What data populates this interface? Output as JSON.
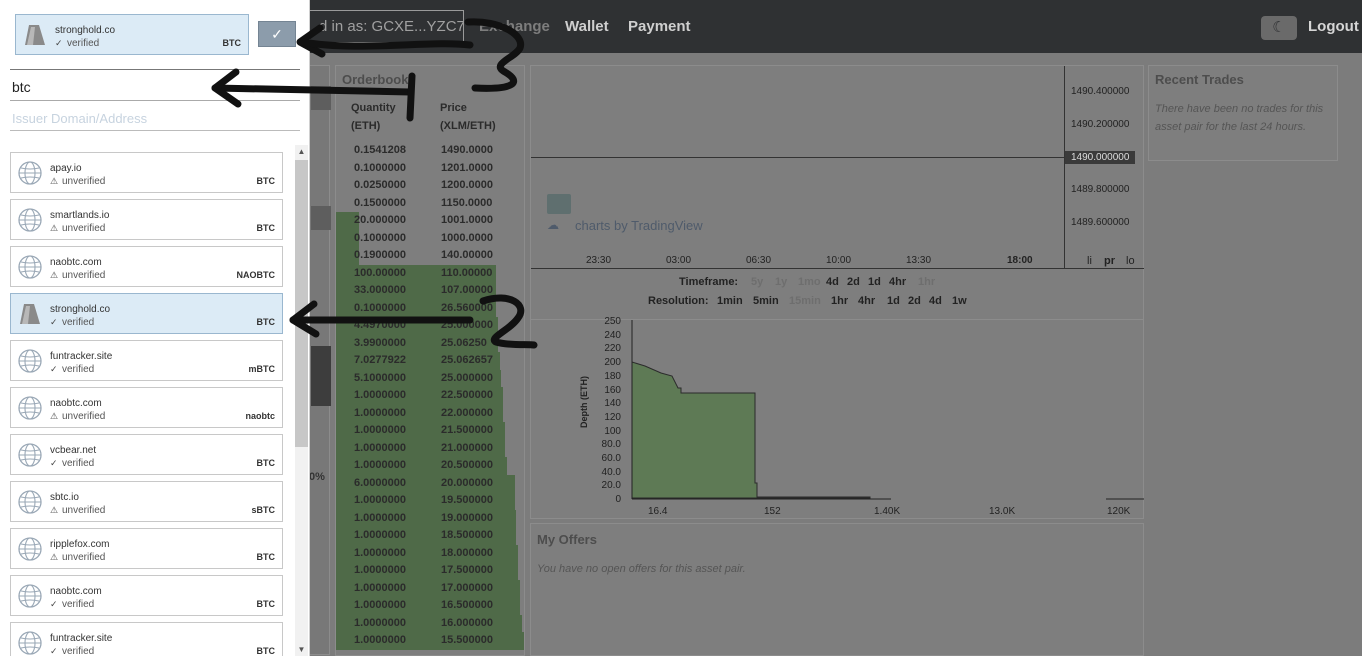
{
  "header": {
    "logged_in_text": "d in as: GCXE...YZC7",
    "nav": [
      "Exchange",
      "Wallet",
      "Payment"
    ],
    "logout": "Logout"
  },
  "orderbook": {
    "title": "Orderbook",
    "col_qty": "Quantity",
    "col_qty_unit": "(ETH)",
    "col_price": "Price",
    "col_price_unit": "(XLM/ETH)",
    "rows": [
      {
        "q": "0.1541208",
        "p": "1490.0000",
        "depth": 0.0
      },
      {
        "q": "0.1000000",
        "p": "1201.0000",
        "depth": 0.0
      },
      {
        "q": "0.0250000",
        "p": "1200.0000",
        "depth": 0.0
      },
      {
        "q": "0.1500000",
        "p": "1150.0000",
        "depth": 0.0
      },
      {
        "q": "20.000000",
        "p": "1001.0000",
        "depth": 0.12
      },
      {
        "q": "0.1000000",
        "p": "1000.0000",
        "depth": 0.12
      },
      {
        "q": "0.1900000",
        "p": "140.00000",
        "depth": 0.12
      },
      {
        "q": "100.00000",
        "p": "110.00000",
        "depth": 0.85
      },
      {
        "q": "33.000000",
        "p": "107.00000",
        "depth": 0.85
      },
      {
        "q": "0.1000000",
        "p": "26.560000",
        "depth": 0.85
      },
      {
        "q": "4.4970000",
        "p": "25.000000",
        "depth": 0.86
      },
      {
        "q": "3.9900000",
        "p": "25.06250",
        "depth": 0.86
      },
      {
        "q": "7.0277922",
        "p": "25.062657",
        "depth": 0.87
      },
      {
        "q": "5.1000000",
        "p": "25.000000",
        "depth": 0.88
      },
      {
        "q": "1.0000000",
        "p": "22.500000",
        "depth": 0.89
      },
      {
        "q": "1.0000000",
        "p": "22.000000",
        "depth": 0.89
      },
      {
        "q": "1.0000000",
        "p": "21.500000",
        "depth": 0.9
      },
      {
        "q": "1.0000000",
        "p": "21.000000",
        "depth": 0.9
      },
      {
        "q": "1.0000000",
        "p": "20.500000",
        "depth": 0.91
      },
      {
        "q": "6.0000000",
        "p": "20.000000",
        "depth": 0.95
      },
      {
        "q": "1.0000000",
        "p": "19.500000",
        "depth": 0.95
      },
      {
        "q": "1.0000000",
        "p": "19.000000",
        "depth": 0.96
      },
      {
        "q": "1.0000000",
        "p": "18.500000",
        "depth": 0.96
      },
      {
        "q": "1.0000000",
        "p": "18.000000",
        "depth": 0.97
      },
      {
        "q": "1.0000000",
        "p": "17.500000",
        "depth": 0.97
      },
      {
        "q": "1.0000000",
        "p": "17.000000",
        "depth": 0.98
      },
      {
        "q": "1.0000000",
        "p": "16.500000",
        "depth": 0.98
      },
      {
        "q": "1.0000000",
        "p": "16.000000",
        "depth": 0.99
      },
      {
        "q": "1.0000000",
        "p": "15.500000",
        "depth": 1.0
      }
    ]
  },
  "price_chart": {
    "y_ticks": [
      "1490.400000",
      "1490.200000",
      "1490.000000",
      "1489.800000",
      "1489.600000"
    ],
    "x_ticks": [
      "23:30",
      "03:00",
      "06:30",
      "10:00",
      "13:30",
      "18:00"
    ],
    "watermark": "charts by TradingView",
    "scale_buttons": [
      "li",
      "pr",
      "lo"
    ],
    "timeframe_label": "Timeframe:",
    "timeframes": [
      "5y",
      "1y",
      "1mo",
      "4d",
      "2d",
      "1d",
      "4hr",
      "1hr"
    ],
    "resolution_label": "Resolution:",
    "resolutions": [
      "1min",
      "5min",
      "15min",
      "1hr",
      "4hr",
      "1d",
      "2d",
      "4d",
      "1w"
    ]
  },
  "depth_chart": {
    "ylabel": "Depth (ETH)",
    "y_ticks": [
      "250",
      "240",
      "220",
      "200",
      "180",
      "160",
      "140",
      "120",
      "100",
      "80.0",
      "60.0",
      "40.0",
      "20.0",
      "0"
    ],
    "x_ticks": [
      "16.4",
      "152",
      "1.40K",
      "13.0K",
      "120K"
    ]
  },
  "my_offers": {
    "title": "My Offers",
    "empty": "You have no open offers for this asset pair."
  },
  "recent_trades": {
    "title": "Recent Trades",
    "empty": "There have been no trades for this asset pair for the last 24 hours."
  },
  "partial_percent": "0%",
  "asset_picker": {
    "selected": {
      "domain": "stronghold.co",
      "status": "verified",
      "code": "BTC"
    },
    "confirm_icon": "checkmark-icon",
    "code_value": "btc",
    "issuer_placeholder": "Issuer Domain/Address",
    "items": [
      {
        "domain": "apay.io",
        "status": "unverified",
        "code": "BTC",
        "icon": "globe-icon",
        "selected": false
      },
      {
        "domain": "smartlands.io",
        "status": "unverified",
        "code": "BTC",
        "icon": "globe-icon",
        "selected": false
      },
      {
        "domain": "naobtc.com",
        "status": "unverified",
        "code": "NAOBTC",
        "icon": "globe-icon",
        "selected": false
      },
      {
        "domain": "stronghold.co",
        "status": "verified",
        "code": "BTC",
        "icon": "stronghold-logo-icon",
        "selected": true
      },
      {
        "domain": "funtracker.site",
        "status": "verified",
        "code": "mBTC",
        "icon": "globe-icon",
        "selected": false
      },
      {
        "domain": "naobtc.com",
        "status": "unverified",
        "code": "naobtc",
        "icon": "globe-icon",
        "selected": false
      },
      {
        "domain": "vcbear.net",
        "status": "verified",
        "code": "BTC",
        "icon": "globe-icon",
        "selected": false
      },
      {
        "domain": "sbtc.io",
        "status": "unverified",
        "code": "sBTC",
        "icon": "globe-icon",
        "selected": false
      },
      {
        "domain": "ripplefox.com",
        "status": "unverified",
        "code": "BTC",
        "icon": "globe-icon",
        "selected": false
      },
      {
        "domain": "naobtc.com",
        "status": "verified",
        "code": "BTC",
        "icon": "globe-icon",
        "selected": false
      },
      {
        "domain": "funtracker.site",
        "status": "verified",
        "code": "BTC",
        "icon": "globe-icon",
        "selected": false
      }
    ]
  },
  "annotations": [
    "1",
    "2"
  ]
}
